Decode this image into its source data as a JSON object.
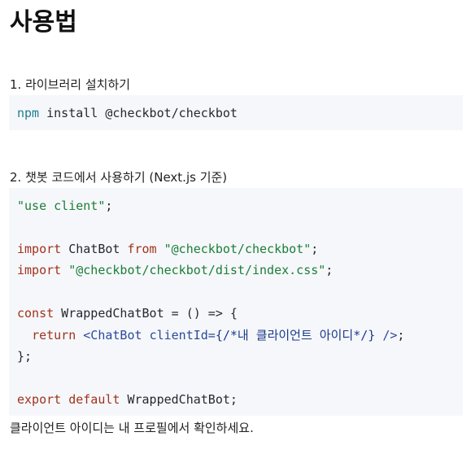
{
  "title": "사용법",
  "step1": {
    "label": "1. 라이브러리 설치하기",
    "code": {
      "cmd": "npm",
      "rest": " install @checkbot/checkbot"
    }
  },
  "step2": {
    "label": "2. 챗봇 코드에서 사용하기 (Next.js 기준)",
    "code": {
      "line1_str": "\"use client\"",
      "line1_end": ";",
      "line2_kw": "import",
      "line2_mid": " ChatBot ",
      "line2_from": "from",
      "line2_sp": " ",
      "line2_str": "\"@checkbot/checkbot\"",
      "line2_end": ";",
      "line3_kw": "import",
      "line3_sp": " ",
      "line3_str": "\"@checkbot/checkbot/dist/index.css\"",
      "line3_end": ";",
      "line4_kw": "const",
      "line4_rest": " WrappedChatBot = () => {",
      "line5_indent": "  ",
      "line5_kw": "return",
      "line5_sp": " ",
      "line5_tag": "<ChatBot",
      "line5_sp2": " ",
      "line5_attr": "clientId=",
      "line5_comment": "{/*내 클라이언트 아이디*/}",
      "line5_close": " />",
      "line5_end": ";",
      "line6": "};",
      "line7_kw": "export default",
      "line7_rest": " WrappedChatBot;"
    }
  },
  "footer": "클라이언트 아이디는 내 프로필에서 확인하세요."
}
